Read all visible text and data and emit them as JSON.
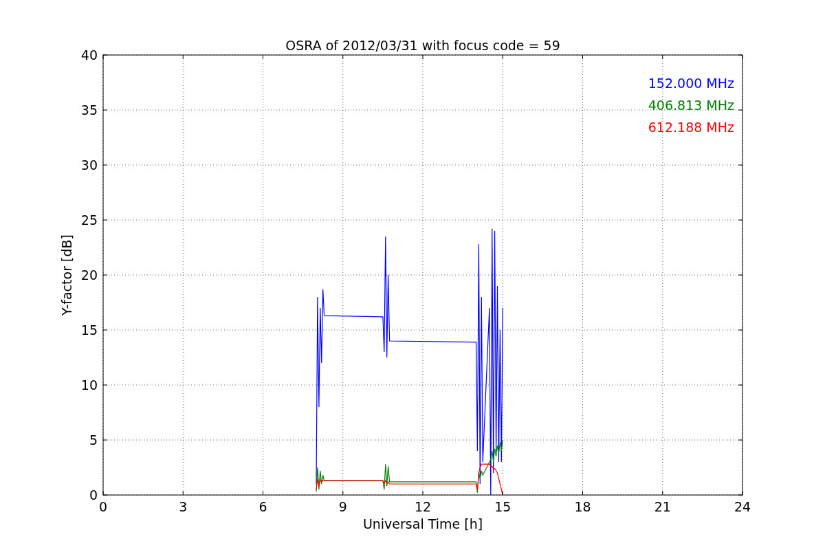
{
  "figure": {
    "chart_data": {
      "type": "line",
      "title": "OSRA of 2012/03/31 with focus code = 59",
      "xlabel": "Universal Time [h]",
      "ylabel": "Y-factor [dB]",
      "x": [
        8.0,
        8.05,
        8.1,
        8.15,
        8.2,
        8.25,
        8.3,
        10.5,
        10.55,
        10.6,
        10.65,
        10.7,
        10.75,
        14.0,
        14.05,
        14.1,
        14.15,
        14.2,
        14.25,
        14.5,
        14.55,
        14.6,
        14.65,
        14.7,
        14.75,
        14.8,
        14.85,
        14.9,
        14.95,
        15.0
      ],
      "series": [
        {
          "name": "152.000 MHz",
          "color": "#0000ff",
          "values": [
            1,
            18,
            8,
            17,
            12,
            18.7,
            16.3,
            16.2,
            13,
            23.5,
            12.5,
            20,
            14,
            13.9,
            4,
            22.8,
            1,
            18,
            3,
            17,
            0,
            24.2,
            2,
            24,
            4,
            19,
            3,
            15,
            3,
            17
          ]
        },
        {
          "name": "406.813 MHz",
          "color": "#008000",
          "values": [
            0.3,
            2.5,
            0.5,
            2.2,
            1,
            1.8,
            1.3,
            1.3,
            0.5,
            2.8,
            0.8,
            2.6,
            1.2,
            1.2,
            0.2,
            2,
            1.5,
            2.2,
            1.8,
            3,
            3.2,
            4,
            3,
            4.2,
            3.5,
            4.5,
            3.8,
            4.8,
            4,
            5
          ]
        },
        {
          "name": "612.188 MHz",
          "color": "#ff0000",
          "values": [
            0.5,
            1.5,
            0.8,
            1.4,
            1.2,
            1.3,
            1.3,
            1.3,
            1.1,
            1.3,
            1,
            1.2,
            1,
            1,
            0.5,
            2,
            2.5,
            2.8,
            2.8,
            2.8,
            2.6,
            2.6,
            2.4,
            2.4,
            2.2,
            2,
            1.5,
            1,
            0.5,
            0
          ]
        }
      ],
      "grid": true,
      "xlim": [
        0,
        24
      ],
      "ylim": [
        0,
        40
      ],
      "xticks": [
        0,
        3,
        6,
        9,
        12,
        15,
        18,
        21,
        24
      ],
      "yticks": [
        0,
        5,
        10,
        15,
        20,
        25,
        30,
        35,
        40
      ]
    }
  }
}
